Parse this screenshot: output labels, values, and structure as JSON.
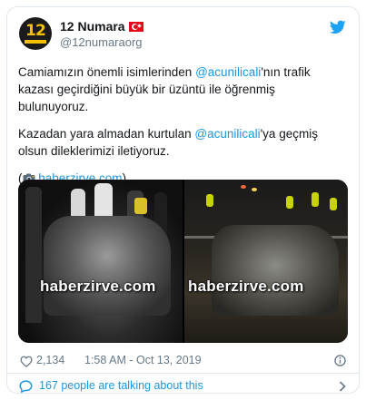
{
  "tweet": {
    "author": {
      "display_name": "12 Numara",
      "handle": "@12numaraorg",
      "avatar_text": "12"
    },
    "text": {
      "p1_before": "Camiamızın önemli isimlerinden ",
      "p1_mention": "@acunilicali",
      "p1_after": "'nın trafik kazası geçirdiğini büyük bir üzüntü ile öğrenmiş bulunuyoruz.",
      "p2_before": "Kazadan yara almadan kurtulan ",
      "p2_mention": "@acunilicali",
      "p2_after": "'ya geçmiş olsun dileklerimizi iletiyoruz.",
      "p3_open": "(",
      "p3_link": "haberzirve.com",
      "p3_close": ")"
    },
    "media": {
      "watermark_left": "haberzirve.com",
      "watermark_right": "haberzirve.com"
    },
    "likes": "2,134",
    "timestamp": "1:58 AM - Oct 13, 2019",
    "conversation": "167 people are talking about this"
  },
  "icons": {
    "flag": "turkey-flag-icon",
    "bird": "twitter-bird-icon",
    "camera": "camera-icon",
    "heart": "heart-icon",
    "info": "info-icon",
    "bubble": "speech-bubble-icon",
    "chevron": "chevron-right-icon"
  },
  "colors": {
    "link": "#1b95e0",
    "muted": "#657786",
    "text": "#14171a",
    "border": "#e1e8ed",
    "brand": "#1da1f2",
    "avatar_accent": "#f2c200"
  }
}
